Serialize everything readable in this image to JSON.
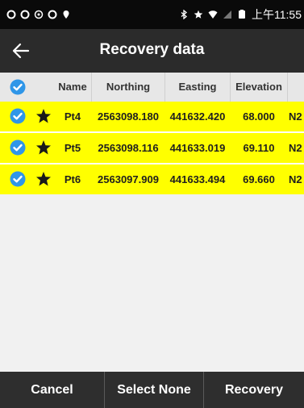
{
  "status_bar": {
    "time": "上午11:55"
  },
  "header": {
    "title": "Recovery data"
  },
  "table": {
    "columns": [
      "Name",
      "Northing",
      "Easting",
      "Elevation"
    ],
    "rows": [
      {
        "name": "Pt4",
        "northing": "2563098.180",
        "easting": "441632.420",
        "elevation": "68.000",
        "extra": "N2"
      },
      {
        "name": "Pt5",
        "northing": "2563098.116",
        "easting": "441633.019",
        "elevation": "69.110",
        "extra": "N2"
      },
      {
        "name": "Pt6",
        "northing": "2563097.909",
        "easting": "441633.494",
        "elevation": "69.660",
        "extra": "N2"
      }
    ]
  },
  "buttons": {
    "cancel": "Cancel",
    "select_none": "Select None",
    "recovery": "Recovery"
  },
  "colors": {
    "row_highlight": "#ffff00",
    "checkbox": "#2f96e8",
    "header_bar": "#2b2b2b",
    "bottom_bar": "#2e2e2e"
  }
}
